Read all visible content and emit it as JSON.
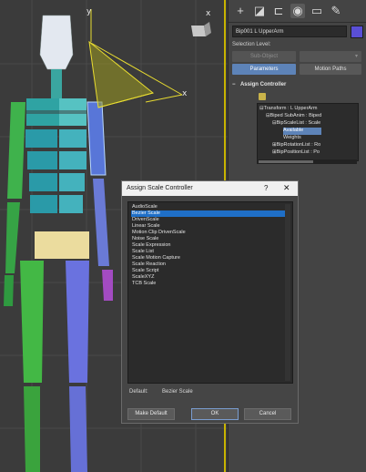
{
  "viewport": {
    "label": "3D viewport",
    "axis_x": "x",
    "axis_y": "y",
    "axis_x2": "x"
  },
  "panel": {
    "tabs": [
      "create-icon",
      "modify-icon",
      "hierarchy-icon",
      "motion-icon",
      "display-icon",
      "utilities-icon"
    ],
    "object_name": "Bip001 L UpperArm",
    "object_color": "#5a4fd6",
    "selection_level_label": "Selection Level:",
    "sub_object_label": "Sub-Object",
    "sub_object_dropdown": "",
    "parameters_label": "Parameters",
    "motion_paths_label": "Motion Paths",
    "rollout_toggle": "−",
    "rollout_title": "Assign Controller",
    "tree": [
      {
        "text": "Transform : L UpperArm",
        "prefix": "⊟"
      },
      {
        "text": "Biped SubAnim : Biped",
        "prefix": "⊟"
      },
      {
        "text": "BipScaleList : Scale",
        "prefix": "⊟"
      },
      {
        "text": "Available",
        "prefix": ""
      },
      {
        "text": "Weights",
        "prefix": ""
      },
      {
        "text": "BipRotationList : Ro",
        "prefix": "⊞"
      },
      {
        "text": "BipPositionList : Po",
        "prefix": "⊞"
      }
    ]
  },
  "dialog": {
    "title": "Assign Scale Controller",
    "help": "?",
    "close": "✕",
    "items": [
      "AudioScale",
      "Bezier Scale",
      "DrivenScale",
      "Linear Scale",
      "Motion Clip DrivenScale",
      "Noise Scale",
      "Scale Expression",
      "Scale List",
      "Scale Motion Capture",
      "Scale Reaction",
      "Scale Script",
      "ScaleXYZ",
      "TCB Scale"
    ],
    "selected_index": 1,
    "default_label": "Default:",
    "default_value": "Bezier Scale",
    "make_default_label": "Make Default",
    "ok_label": "OK",
    "cancel_label": "Cancel"
  }
}
